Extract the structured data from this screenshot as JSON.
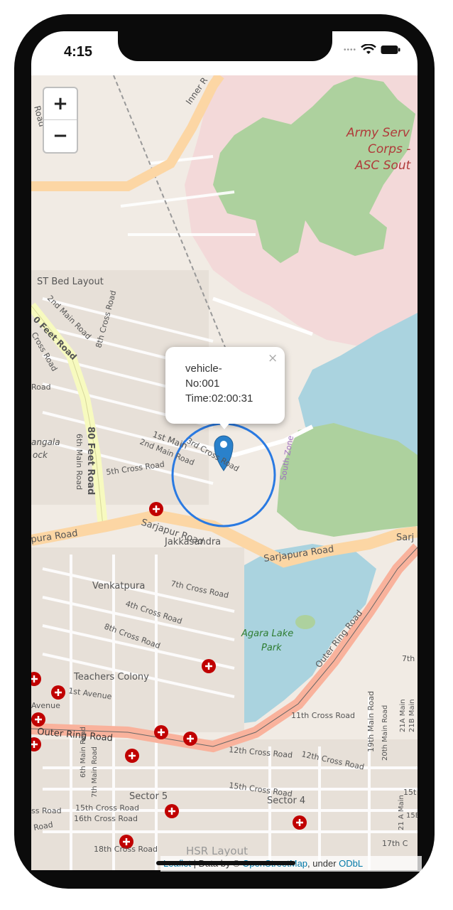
{
  "status_bar": {
    "time": "4:15"
  },
  "map": {
    "zoom_in_label": "+",
    "zoom_out_label": "−",
    "labels": {
      "army": [
        "Army Serv",
        "Corps -",
        "ASC Sout"
      ],
      "inner_road": "Inner R",
      "road_top_left": "Road",
      "st_bed": "ST Bed Layout",
      "second_main": "2nd Main Road",
      "eighth_cross": "8th Cross Road",
      "cross_road": "Cross Road",
      "feet_road": "0 Feet Road",
      "eighty_feet": "80 Feet Road",
      "sixth_main": "6th Main Road",
      "road_left": "Road",
      "mangala": "angala",
      "block": "ock",
      "first_main": "1st Main",
      "second_main_b": "2nd Main Road",
      "third_cross": "3rd Cross Road",
      "fifth_cross": "5th Cross Road",
      "south_zone": "South Zone",
      "sarjapur_road_left": "pura Road",
      "sarjapur_road_mid": "Sarjapur Road",
      "sarjapura_road": "Sarjapura Road",
      "sarj_right": "Sarj",
      "jakkasandra": "Jakkasandra",
      "venkatpura": "Venkatpura",
      "seventh_cross": "7th Cross Road",
      "fourth_cross": "4th Cross Road",
      "eighth_cross_b": "8th Cross Road",
      "agara_lake": [
        "Agara Lake",
        "Park"
      ],
      "outer_ring_diag": "Outer Ring Road",
      "seventh_right": "7th",
      "teachers_colony": "Teachers Colony",
      "first_avenue": "1st Avenue",
      "avenue": "Avenue",
      "outer_ring_left": "Outer Ring Road",
      "eleventh_cross": "11th Cross Road",
      "nineteenth_main": "19th Main Road",
      "twentieth_main": "20th Main Road",
      "twentyone_a": "21A Main",
      "twentyone_b": "21B Main",
      "twelfth_cross_a": "12th Cross Road",
      "twelfth_cross_b": "12th Cross Road",
      "sixth_main_b": "6th Main Road",
      "seventh_main": "7th Main Road",
      "fifteenth_cross": "15th Cross Road",
      "sixteenth_cross": "16th Cross Road",
      "sector5": "Sector 5",
      "fifteenth_cross_b": "15th Cross Road",
      "sector4": "Sector 4",
      "ss_road": "ss Road",
      "road_bottom": "Road",
      "eighteenth_cross": "18th Cross Road",
      "hsr": "HSR Layout",
      "seventeenth_c": "17th C",
      "twentyone_main_v": "21 A Main",
      "fifteen_r": "15t",
      "fifteen_b": "15B"
    }
  },
  "popup": {
    "lines": [
      "vehicle-",
      "No:001",
      "Time:02:00:31"
    ],
    "close": "×"
  },
  "attribution": {
    "leaflet": "Leaflet",
    "text": " | Data by © ",
    "osm": "OpenStreetMap",
    "under": ", under ",
    "odbl": "ODbL"
  },
  "colors": {
    "road_primary": "#fcd6a4",
    "road_trunk": "#f9b29c",
    "road_secondary": "#f7fabf",
    "water": "#aad3df",
    "park": "#add19e",
    "military": "#f3d9d9",
    "marker": "#2a81cb",
    "hospital": "#c00000"
  }
}
